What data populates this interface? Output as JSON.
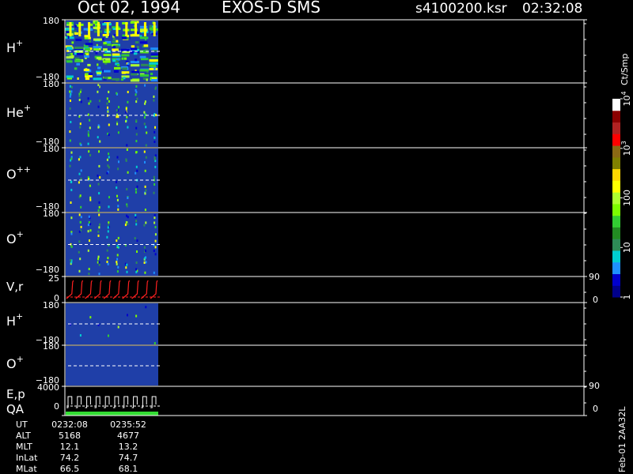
{
  "header": {
    "date": "Oct 02, 1994",
    "instrument": "EXOS-D SMS",
    "file": "s4100200.ksr",
    "time": "02:32:08"
  },
  "colorbar": {
    "unit": "Ct/Smp",
    "ticks": [
      {
        "label": "1",
        "value": 1
      },
      {
        "label": "10",
        "value": 10
      },
      {
        "label": "100",
        "value": 100
      },
      {
        "label": "10",
        "sup": "3",
        "value": 1000
      },
      {
        "label": "10",
        "sup": "4",
        "value": 10000
      }
    ],
    "colors": [
      "#00008b",
      "#0000cd",
      "#1e90ff",
      "#00ced1",
      "#2e8b57",
      "#228b22",
      "#32cd32",
      "#7cfc00",
      "#adff2f",
      "#ffff00",
      "#ffd700",
      "#808000",
      "#8b6914",
      "#ff0000",
      "#b22222",
      "#8b0000",
      "#ffffff"
    ]
  },
  "right_labels": {
    "vr_top": "90",
    "vr_bottom": "0",
    "ep_top": "90",
    "ep_bottom": "0"
  },
  "panels": {
    "h_plus": {
      "name": "H",
      "sup": "+",
      "ymax": "180",
      "ymin": "−180"
    },
    "he_plus": {
      "name": "He",
      "sup": "+",
      "ymax": "180",
      "ymin": "−180"
    },
    "o_pp": {
      "name": "O",
      "sup": "++",
      "ymax": "180",
      "ymin": "−180"
    },
    "o_plus": {
      "name": "O",
      "sup": "+",
      "ymax": "180",
      "ymin": "−180"
    },
    "vr": {
      "name": "V,r",
      "ymax": "25",
      "ymin": "0"
    },
    "h_plus2": {
      "name": "H",
      "sup": "+",
      "ymax": "180",
      "ymin": "−180"
    },
    "o_plus2": {
      "name": "O",
      "sup": "+",
      "ymax": "180",
      "ymin": "−180"
    },
    "ep": {
      "name": "E,p",
      "ymax": "4000",
      "ymin": "0"
    },
    "qa": {
      "name": "QA"
    }
  },
  "ephemeris": {
    "rows": [
      {
        "label": "UT",
        "v1": "0232:08",
        "v2": "0235:52"
      },
      {
        "label": "ALT",
        "v1": "5168",
        "v2": "4677"
      },
      {
        "label": "MLT",
        "v1": "12.1",
        "v2": "13.2"
      },
      {
        "label": "InLat",
        "v1": "74.2",
        "v2": "74.7"
      },
      {
        "label": "MLat",
        "v1": "66.5",
        "v2": "68.1"
      }
    ]
  },
  "footer": {
    "stamp": "Feb-01 2AA32L"
  },
  "chart_data": {
    "type": "heatmap",
    "title": "Oct 02, 1994   EXOS-D SMS",
    "time_range": [
      "0232:08",
      "0235:52"
    ],
    "data_fraction_of_axis": 0.18,
    "spin_cycles": 10,
    "spectrogram_panels": [
      "H+",
      "He+",
      "O++",
      "O+",
      "H+",
      "O+"
    ],
    "ylim_angle": [
      -180,
      180
    ],
    "ylim_vr": [
      0,
      25
    ],
    "ylim_ep": [
      0,
      4000
    ],
    "colorbar_range": [
      1,
      10000
    ],
    "colorbar_scale": "log"
  }
}
